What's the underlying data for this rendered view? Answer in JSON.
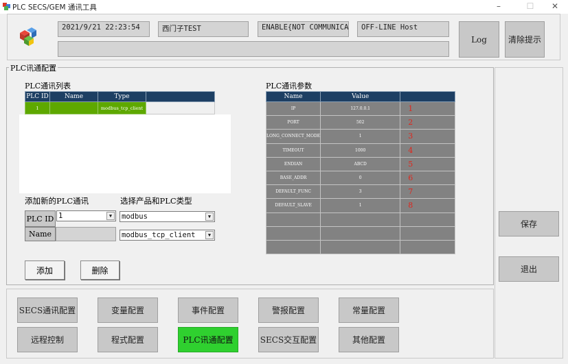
{
  "window": {
    "title": "PLC SECS/GEM 通讯工具",
    "minimize": "–",
    "maximize": "☐",
    "close": "✕"
  },
  "header": {
    "datetime": "2021/9/21 22:23:54",
    "device": "西门子TEST",
    "comm_status": "ENABLE{NOT COMMUNICATI",
    "host_status": "OFF-LINE Host",
    "message": "",
    "log_label": "Log",
    "clear_label": "清除提示"
  },
  "plc_group": {
    "label": "PLC讯通配置",
    "list_title": "PLC通讯列表",
    "list_columns": [
      "PLC ID",
      "Name",
      "Type"
    ],
    "list_rows": [
      {
        "id": "1",
        "name": "",
        "type": "modbus_tcp_client"
      }
    ],
    "params_title": "PLC通讯参数",
    "params_columns": [
      "Name",
      "Value"
    ],
    "params_rows": [
      {
        "name": "IP",
        "value": "127.0.0.1",
        "idx": "1"
      },
      {
        "name": "PORT",
        "value": "502",
        "idx": "2"
      },
      {
        "name": "LONG_CONNECT_MODE",
        "value": "1",
        "idx": "3"
      },
      {
        "name": "TIMEOUT",
        "value": "1000",
        "idx": "4"
      },
      {
        "name": "ENDIAN",
        "value": "ABCD",
        "idx": "5"
      },
      {
        "name": "BASE_ADDR",
        "value": "0",
        "idx": "6"
      },
      {
        "name": "DEFAULT_FUNC",
        "value": "3",
        "idx": "7"
      },
      {
        "name": "DEFAULT_SLAVE",
        "value": "1",
        "idx": "8"
      },
      {
        "name": "",
        "value": "",
        "idx": ""
      },
      {
        "name": "",
        "value": "",
        "idx": ""
      },
      {
        "name": "",
        "value": "",
        "idx": ""
      }
    ],
    "add_title": "添加新的PLC通讯",
    "type_title": "选择产品和PLC类型",
    "plc_id_label": "PLC ID",
    "plc_id_value": "1",
    "name_label": "Name",
    "product_value": "modbus",
    "plc_type_value": "modbus_tcp_client",
    "add_label": "添加",
    "delete_label": "删除"
  },
  "side": {
    "save_label": "保存",
    "exit_label": "退出"
  },
  "nav": {
    "row1": [
      "SECS通讯配置",
      "变量配置",
      "事件配置",
      "警报配置",
      "常量配置"
    ],
    "row2": [
      "远程控制",
      "程式配置",
      "PLC讯通配置",
      "SECS交互配置",
      "其他配置"
    ],
    "active": "PLC讯通配置"
  },
  "colors": {
    "table_header": "#1d3f63",
    "selected_row": "#5ea800",
    "param_cell": "#828282",
    "index_red": "#e0261c",
    "active_nav": "#2fd02f"
  }
}
